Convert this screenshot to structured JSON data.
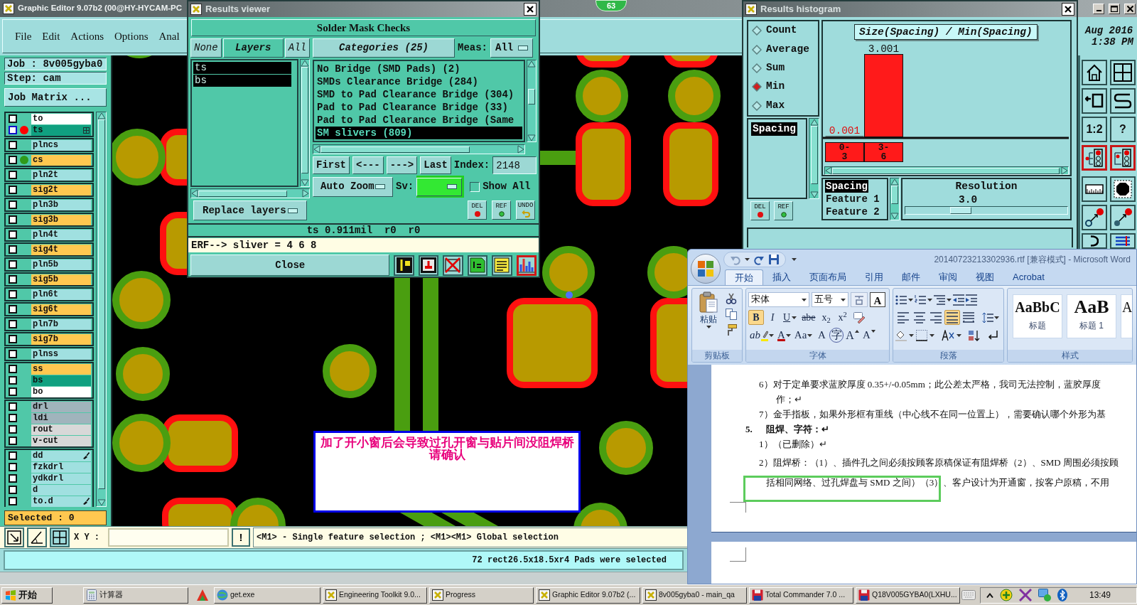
{
  "editor": {
    "title": "Graphic Editor 9.07b2 (00@HY-HYCAM-PC",
    "badge": "63",
    "menu": [
      "File",
      "Edit",
      "Actions",
      "Options",
      "Anal"
    ],
    "date": "Aug 2016",
    "time": "1:38 PM",
    "job": "Job : 8v005gyba0",
    "step": "Step: cam",
    "job_matrix": "Job Matrix ...",
    "layer_groups": [
      {
        "layers": [
          {
            "name": "to",
            "color": "#ffffff",
            "checkbox": {
              "checked": false,
              "color": "#101010"
            },
            "kind": "plain"
          },
          {
            "name": "ts",
            "color": "#10a080",
            "checkbox": {
              "checked": false,
              "color": "#1010c8"
            },
            "dot": {
              "color": "#ff0000"
            },
            "kind": "grid"
          }
        ]
      },
      {
        "layers": [
          {
            "name": "plncs",
            "color": "#a0e0e0",
            "checkbox": {
              "checked": false,
              "color": "#101010"
            },
            "kind": "plain"
          }
        ]
      },
      {
        "layers": [
          {
            "name": "cs",
            "color": "#ffc850",
            "checkbox": {
              "checked": false,
              "color": "#101010"
            },
            "dot": {
              "color": "#2f9a1a"
            },
            "kind": "plain"
          }
        ]
      },
      {
        "layers": [
          {
            "name": "pln2t",
            "color": "#a0e0e0",
            "checkbox": {
              "checked": false,
              "color": "#101010"
            },
            "kind": "plain"
          }
        ]
      },
      {
        "layers": [
          {
            "name": "sig2t",
            "color": "#ffc850",
            "checkbox": {
              "checked": false,
              "color": "#101010"
            },
            "kind": "plain"
          }
        ]
      },
      {
        "layers": [
          {
            "name": "pln3b",
            "color": "#a0e0e0",
            "checkbox": {
              "checked": false,
              "color": "#101010"
            },
            "kind": "plain"
          }
        ]
      },
      {
        "layers": [
          {
            "name": "sig3b",
            "color": "#ffc850",
            "checkbox": {
              "checked": false,
              "color": "#101010"
            },
            "kind": "plain"
          }
        ]
      },
      {
        "layers": [
          {
            "name": "pln4t",
            "color": "#a0e0e0",
            "checkbox": {
              "checked": false,
              "color": "#101010"
            },
            "kind": "plain"
          }
        ]
      },
      {
        "layers": [
          {
            "name": "sig4t",
            "color": "#ffc850",
            "checkbox": {
              "checked": false,
              "color": "#101010"
            },
            "kind": "plain"
          }
        ]
      },
      {
        "layers": [
          {
            "name": "pln5b",
            "color": "#a0e0e0",
            "checkbox": {
              "checked": false,
              "color": "#101010"
            },
            "kind": "plain"
          }
        ]
      },
      {
        "layers": [
          {
            "name": "sig5b",
            "color": "#ffc850",
            "checkbox": {
              "checked": false,
              "color": "#101010"
            },
            "kind": "plain"
          }
        ]
      },
      {
        "layers": [
          {
            "name": "pln6t",
            "color": "#a0e0e0",
            "checkbox": {
              "checked": false,
              "color": "#101010"
            },
            "kind": "plain"
          }
        ]
      },
      {
        "layers": [
          {
            "name": "sig6t",
            "color": "#ffc850",
            "checkbox": {
              "checked": false,
              "color": "#101010"
            },
            "kind": "plain"
          }
        ]
      },
      {
        "layers": [
          {
            "name": "pln7b",
            "color": "#a0e0e0",
            "checkbox": {
              "checked": false,
              "color": "#101010"
            },
            "kind": "plain"
          }
        ]
      },
      {
        "layers": [
          {
            "name": "sig7b",
            "color": "#ffc850",
            "checkbox": {
              "checked": false,
              "color": "#101010"
            },
            "kind": "plain"
          }
        ]
      },
      {
        "layers": [
          {
            "name": "plnss",
            "color": "#a0e0e0",
            "checkbox": {
              "checked": false,
              "color": "#101010"
            },
            "kind": "plain"
          }
        ]
      },
      {
        "layers": [
          {
            "name": "ss",
            "color": "#ffc850",
            "checkbox": {
              "checked": false,
              "color": "#101010"
            },
            "kind": "plain"
          },
          {
            "name": "bs",
            "color": "#10a080",
            "checkbox": {
              "checked": false,
              "color": "#101010"
            },
            "kind": "plain"
          },
          {
            "name": "bo",
            "color": "#ffffff",
            "checkbox": {
              "checked": false,
              "color": "#101010"
            },
            "kind": "plain"
          }
        ]
      },
      {
        "layers": [
          {
            "name": "drl",
            "color": "#a0b4bc",
            "checkbox": {
              "checked": false,
              "color": "#101010"
            },
            "kind": "plain"
          },
          {
            "name": "ldi",
            "color": "#a0b4bc",
            "checkbox": {
              "checked": false,
              "color": "#101010"
            },
            "kind": "plain"
          },
          {
            "name": "rout",
            "color": "#d8d8d8",
            "checkbox": {
              "checked": false,
              "color": "#101010"
            },
            "kind": "plain"
          },
          {
            "name": "v-cut",
            "color": "#d8d8d8",
            "checkbox": {
              "checked": false,
              "color": "#101010"
            },
            "kind": "plain"
          }
        ]
      },
      {
        "layers": [
          {
            "name": "dd",
            "color": "#a0e0e0",
            "checkbox": {
              "checked": false,
              "color": "#101010"
            },
            "kind": "brush"
          },
          {
            "name": "fzkdrl",
            "color": "#a0e0e0",
            "checkbox": {
              "checked": false,
              "color": "#101010"
            },
            "kind": "plain"
          },
          {
            "name": "ydkdrl",
            "color": "#a0e0e0",
            "checkbox": {
              "checked": false,
              "color": "#101010"
            },
            "kind": "plain"
          },
          {
            "name": "d",
            "color": "#a0e0e0",
            "checkbox": {
              "checked": false,
              "color": "#101010"
            },
            "kind": "plain"
          },
          {
            "name": "to.d",
            "color": "#a0e0e0",
            "checkbox": {
              "checked": false,
              "color": "#101010"
            },
            "kind": "brush"
          }
        ]
      }
    ],
    "selected_count": "Selected : 0",
    "note": "加了开小窗后会导致过孔开窗与贴片间没阻焊桥请确认",
    "side_tools": [
      {
        "selected": false
      },
      {
        "selected": false
      },
      {
        "selected": false
      },
      {
        "selected": false
      },
      {
        "label": "1:2",
        "selected": false
      },
      {
        "label": "?",
        "selected": false
      },
      {
        "selected": true
      },
      {
        "selected": true
      },
      {
        "selected": false
      },
      {
        "selected": false
      },
      {
        "selected": false
      },
      {
        "selected": false
      },
      {
        "selected": false
      },
      {
        "selected": false
      }
    ],
    "bottom_tools": [
      {
        "selected": false
      },
      {
        "selected": false
      },
      {
        "selected": true
      }
    ],
    "xy_label": "X Y :",
    "alert": "!",
    "message": "<M1> - Single feature selection ; <M1><M1> Global selection",
    "status": "72 rect26.5x18.5xr4 Pads were selected"
  },
  "results_viewer": {
    "title": "Results viewer",
    "header": "Solder Mask Checks",
    "layer_buttons": [
      {
        "label": "None",
        "kind": "action"
      },
      {
        "label": "Layers",
        "kind": "title"
      },
      {
        "label": "All",
        "kind": "action"
      }
    ],
    "layers": [
      {
        "name": "ts",
        "selected": true
      },
      {
        "name": "bs",
        "selected": true
      }
    ],
    "replace": "Replace layers",
    "categories_button": "Categories (25)",
    "meas_label": "Meas:",
    "meas_value": "All",
    "categories": [
      {
        "name": "No Bridge (SMD Pads) (2)",
        "selected": false
      },
      {
        "name": "SMDs Clearance Bridge (284)",
        "selected": false
      },
      {
        "name": "SMD to Pad Clearance Bridge (304)",
        "selected": false
      },
      {
        "name": "Pad to Pad Clearance Bridge (33)",
        "selected": false
      },
      {
        "name": "Pad to Pad Clearance Bridge (Same",
        "selected": false
      },
      {
        "name": "SM slivers (809)",
        "selected": true
      }
    ],
    "nav": [
      "First",
      "<---",
      "--->",
      "Last"
    ],
    "index_label": "Index:",
    "index_value": "2148",
    "auto_zoom": "Auto Zoom",
    "sv_label": "Sv:",
    "show_all": {
      "label": "Show All",
      "checked": false
    },
    "edit_buttons": [
      {
        "label": "DEL",
        "kind": "delete"
      },
      {
        "label": "REF",
        "kind": "reference"
      },
      {
        "label": "UNDO",
        "kind": "undo"
      }
    ],
    "measurement": "ts 0.911mil  r0  r0",
    "erf": "ERF--> sliver = 4 6 8",
    "close": "Close",
    "tools": [
      {
        "selected": false
      },
      {
        "selected": false
      },
      {
        "selected": false
      },
      {
        "selected": false
      },
      {
        "selected": false
      },
      {
        "selected": true
      }
    ]
  },
  "results_histogram": {
    "title": "Results histogram",
    "modes": [
      {
        "label": "Count",
        "selected": false
      },
      {
        "label": "Average",
        "selected": false
      },
      {
        "label": "Sum",
        "selected": false
      },
      {
        "label": "Min",
        "selected": true
      },
      {
        "label": "Max",
        "selected": false
      }
    ],
    "measures": [
      {
        "label": "Spacing",
        "selected": true
      }
    ],
    "edit_buttons": [
      {
        "label": "DEL",
        "kind": "delete"
      },
      {
        "label": "REF",
        "kind": "reference"
      }
    ],
    "chart_data": {
      "type": "bar",
      "title": "Size(Spacing) / Min(Spacing)",
      "categories": [
        "0-3",
        "3-6"
      ],
      "values": [
        0.001,
        3.001
      ],
      "data_labels": true
    },
    "fields": [
      {
        "label": "Spacing",
        "selected": true
      },
      {
        "label": "Feature 1",
        "selected": false
      },
      {
        "label": "Feature 2",
        "selected": false
      }
    ],
    "resolution": {
      "label": "Resolution",
      "value": "3.0",
      "level": 0.32
    }
  },
  "word": {
    "title": "20140723213302936.rtf [兼容模式] - Microsoft Word",
    "tabs": [
      {
        "label": "开始",
        "selected": true
      },
      {
        "label": "插入",
        "selected": false
      },
      {
        "label": "页面布局",
        "selected": false
      },
      {
        "label": "引用",
        "selected": false
      },
      {
        "label": "邮件",
        "selected": false
      },
      {
        "label": "审阅",
        "selected": false
      },
      {
        "label": "视图",
        "selected": false
      },
      {
        "label": "Acrobat",
        "selected": false
      }
    ],
    "clipboard": {
      "paste": "粘贴",
      "label": "剪贴板"
    },
    "font": {
      "name": "宋体",
      "size": "五号",
      "border_char": "A",
      "label": "字体",
      "row2": [
        {
          "kind": "bold",
          "label": "B",
          "on": true
        },
        {
          "kind": "italic",
          "label": "I",
          "on": false
        },
        {
          "kind": "underline",
          "label": "U",
          "on": false
        },
        {
          "kind": "strike",
          "label": "abe",
          "on": false
        },
        {
          "kind": "sub",
          "label": "x$_{2}$",
          "on": false
        },
        {
          "kind": "super",
          "label": "x$^{2}$",
          "on": false
        },
        {
          "kind": "clear",
          "on": false
        }
      ],
      "row3": [
        {
          "kind": "highlight",
          "label": "ab"
        },
        {
          "kind": "color",
          "label": "A"
        },
        {
          "kind": "case",
          "label": "Aa"
        },
        {
          "kind": "shade",
          "label": "A"
        },
        {
          "kind": "enclose",
          "label": "字"
        },
        {
          "kind": "grow",
          "label": "A"
        },
        {
          "kind": "shrink",
          "label": "A"
        }
      ]
    },
    "paragraph": {
      "label": "段落",
      "align": [
        {
          "selected": false
        },
        {
          "selected": false
        },
        {
          "selected": false
        },
        {
          "selected": true
        },
        {
          "selected": false
        }
      ]
    },
    "styles": {
      "label": "样式",
      "items": [
        {
          "sample": "AaBbC",
          "name": "标题",
          "kind": "title"
        },
        {
          "sample": "AaB",
          "name": "标题 1",
          "kind": "heading"
        },
        {
          "sample": "A",
          "kind": "normal"
        }
      ]
    },
    "lines": [
      {
        "kind": "item",
        "text": "6）对于定单要求蓝胶厚度 0.35+/-0.05mm；此公差太严格，我司无法控制，蓝胶厚度"
      },
      {
        "kind": "wrap",
        "text": "作；↵"
      },
      {
        "kind": "item",
        "text": "7）金手指板，如果外形框有重线（中心线不在同一位置上），需要确认哪个外形为基"
      },
      {
        "kind": "heading",
        "number": "5.",
        "text": "阻焊、字符：↵"
      },
      {
        "kind": "item",
        "text": "1）（已删除）↵"
      },
      {
        "kind": "para",
        "text": "2）阻焊桥：（1）、插件孔之间必须按顾客原稿保证有阻焊桥（2）、SMD 周围必须按顾"
      },
      {
        "kind": "para-wrap",
        "text": "括相同网络、过孔焊盘与 SMD 之间）（3）、客户设计为开通窗，按客户原稿，不用"
      }
    ]
  },
  "taskbar": {
    "start": "开始",
    "items": [
      {
        "label": "计算器",
        "kind": "calculator"
      },
      {
        "label": "get.exe",
        "kind": "globe"
      },
      {
        "label": "Engineering Toolkit 9.0...",
        "kind": "app"
      },
      {
        "label": "Progress",
        "kind": "app"
      },
      {
        "label": "Graphic Editor 9.07b2 (...",
        "kind": "app"
      },
      {
        "label": "8v005gyba0 - main_qa",
        "kind": "app"
      },
      {
        "label": "Total Commander 7.0 ...",
        "kind": "disk"
      },
      {
        "label": "Q18V005GYBA0(LXHU...",
        "kind": "disk"
      }
    ],
    "clock": "13:49"
  }
}
